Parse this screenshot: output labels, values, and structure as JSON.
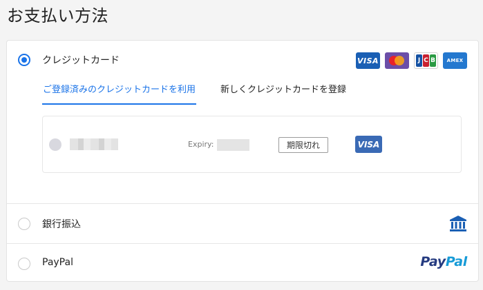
{
  "page": {
    "title": "お支払い方法"
  },
  "payment_methods": {
    "credit_card": {
      "label": "クレジットカード",
      "selected": true,
      "brands": {
        "visa": "VISA",
        "mastercard": "mastercard-icon",
        "jcb": [
          "J",
          "C",
          "B"
        ],
        "amex": "AMEX"
      },
      "tabs": {
        "saved": "ご登録済みのクレジットカードを利用",
        "new": "新しくクレジットカードを登録"
      },
      "saved_card": {
        "expiry_label": "Expiry:",
        "status": "期限切れ",
        "brand": "VISA"
      }
    },
    "bank_transfer": {
      "label": "銀行振込",
      "selected": false,
      "icon": "bank-icon"
    },
    "paypal": {
      "label": "PayPal",
      "selected": false,
      "logo_part1": "Pay",
      "logo_part2": "Pal"
    }
  },
  "colors": {
    "accent": "#1a73e8",
    "visa": "#1a5fb4",
    "paypal_dark": "#253b80",
    "paypal_light": "#179bd7"
  }
}
